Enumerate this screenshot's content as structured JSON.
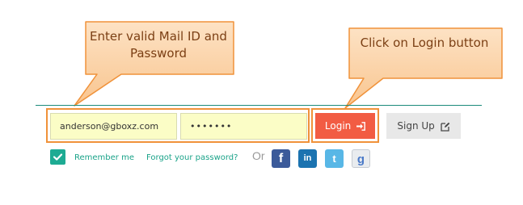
{
  "callouts": {
    "fields_note": "Enter valid Mail ID and Password",
    "login_note": "Click on Login button"
  },
  "login_form": {
    "email_value": "anderson@gboxz.com",
    "password_value": "•••••••",
    "login_label": "Login",
    "signup_label": "Sign Up",
    "remember_label": "Remember me",
    "forgot_label": "Forgot your password?",
    "or_label": "Or"
  },
  "social": {
    "facebook_glyph": "f",
    "linkedin_glyph": "in",
    "twitter_glyph": "t",
    "google_glyph": "g"
  },
  "colors": {
    "accent_teal": "#1dab93",
    "login_button": "#f25c43",
    "callout_fill": "#fbd3a7",
    "callout_border": "#f0923a",
    "input_background": "#fbfdc6"
  }
}
